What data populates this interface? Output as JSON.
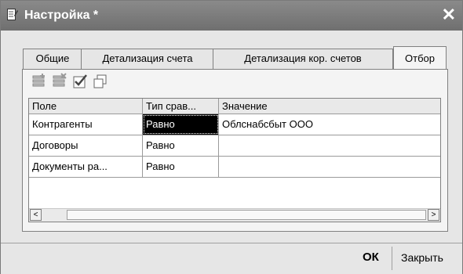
{
  "window": {
    "title": "Настройка *",
    "close_glyph": "✕"
  },
  "tabs": [
    {
      "label": "Общие"
    },
    {
      "label": "Детализация счета"
    },
    {
      "label": "Детализация кор. счетов"
    },
    {
      "label": "Отбор",
      "active": true
    }
  ],
  "toolbar": {
    "icons": [
      "add-row-icon",
      "delete-row-icon",
      "check-all-icon",
      "copy-icon"
    ]
  },
  "table": {
    "headers": [
      "Поле",
      "Тип срав...",
      "Значение"
    ],
    "rows": [
      {
        "field": "Контрагенты",
        "type": "Равно",
        "value": "Облснабсбыт ООО"
      },
      {
        "field": "Договоры",
        "type": "Равно",
        "value": ""
      },
      {
        "field": "Документы ра...",
        "type": "Равно",
        "value": ""
      }
    ]
  },
  "scrollbar": {
    "left_glyph": "<",
    "right_glyph": ">"
  },
  "footer": {
    "ok_label": "ОК",
    "close_label": "Закрыть"
  }
}
